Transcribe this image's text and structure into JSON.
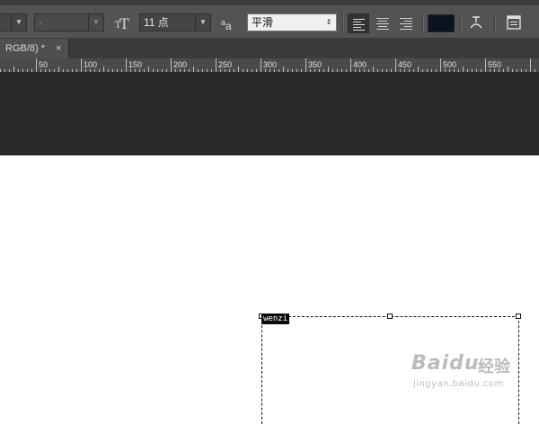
{
  "options_bar": {
    "font_style_value": "",
    "font_size_value": "-",
    "text_size": "11 点",
    "antialias_label": "a",
    "antialias_label_small": "a",
    "antialias_value": "平滑",
    "text_color": "#0a1420",
    "icons": [
      "font-size-icon",
      "antialias-icon",
      "align-left-icon",
      "align-center-icon",
      "align-right-icon",
      "warp-text-icon",
      "character-panel-icon"
    ]
  },
  "document_tab": {
    "title": "RGB/8) *",
    "close_label": "×"
  },
  "ruler": {
    "labels": [
      "50",
      "100",
      "150",
      "200",
      "250",
      "300",
      "350",
      "400",
      "450",
      "500",
      "550"
    ]
  },
  "canvas": {
    "text_layer_label": "wenzi"
  },
  "watermark": {
    "main": "Baidu",
    "cn": "经验",
    "url": "jingyan.baidu.com"
  }
}
